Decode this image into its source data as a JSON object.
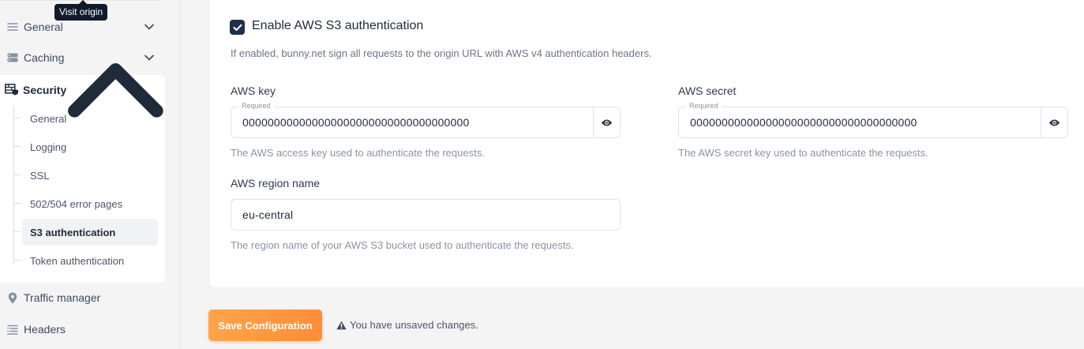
{
  "tooltip": {
    "text": "Visit origin"
  },
  "sidebar": {
    "general": "General",
    "caching": "Caching",
    "security": {
      "label": "Security",
      "items": [
        {
          "label": "General"
        },
        {
          "label": "Logging"
        },
        {
          "label": "SSL"
        },
        {
          "label": "502/504 error pages"
        },
        {
          "label": "S3 authentication"
        },
        {
          "label": "Token authentication"
        }
      ]
    },
    "traffic_manager": "Traffic manager",
    "headers": "Headers"
  },
  "main": {
    "enable_label": "Enable AWS S3 authentication",
    "enable_checked": true,
    "description": "If enabled, bunny.net sign all requests to the origin URL with AWS v4 authentication headers.",
    "aws_key": {
      "label": "AWS key",
      "required": "Required",
      "value": "000000000000000000000000000000000000",
      "help": "The AWS access key used to authenticate the requests."
    },
    "aws_secret": {
      "label": "AWS secret",
      "required": "Required",
      "value": "000000000000000000000000000000000000",
      "help": "The AWS secret key used to authenticate the requests."
    },
    "aws_region": {
      "label": "AWS region name",
      "value": "eu-central",
      "help": "The region name of your AWS S3 bucket used to authenticate the requests."
    }
  },
  "footer": {
    "save_label": "Save Configuration",
    "unsaved_text": "You have unsaved changes."
  },
  "colors": {
    "accent": "#ff8c3a",
    "checkbox": "#1e3047"
  }
}
